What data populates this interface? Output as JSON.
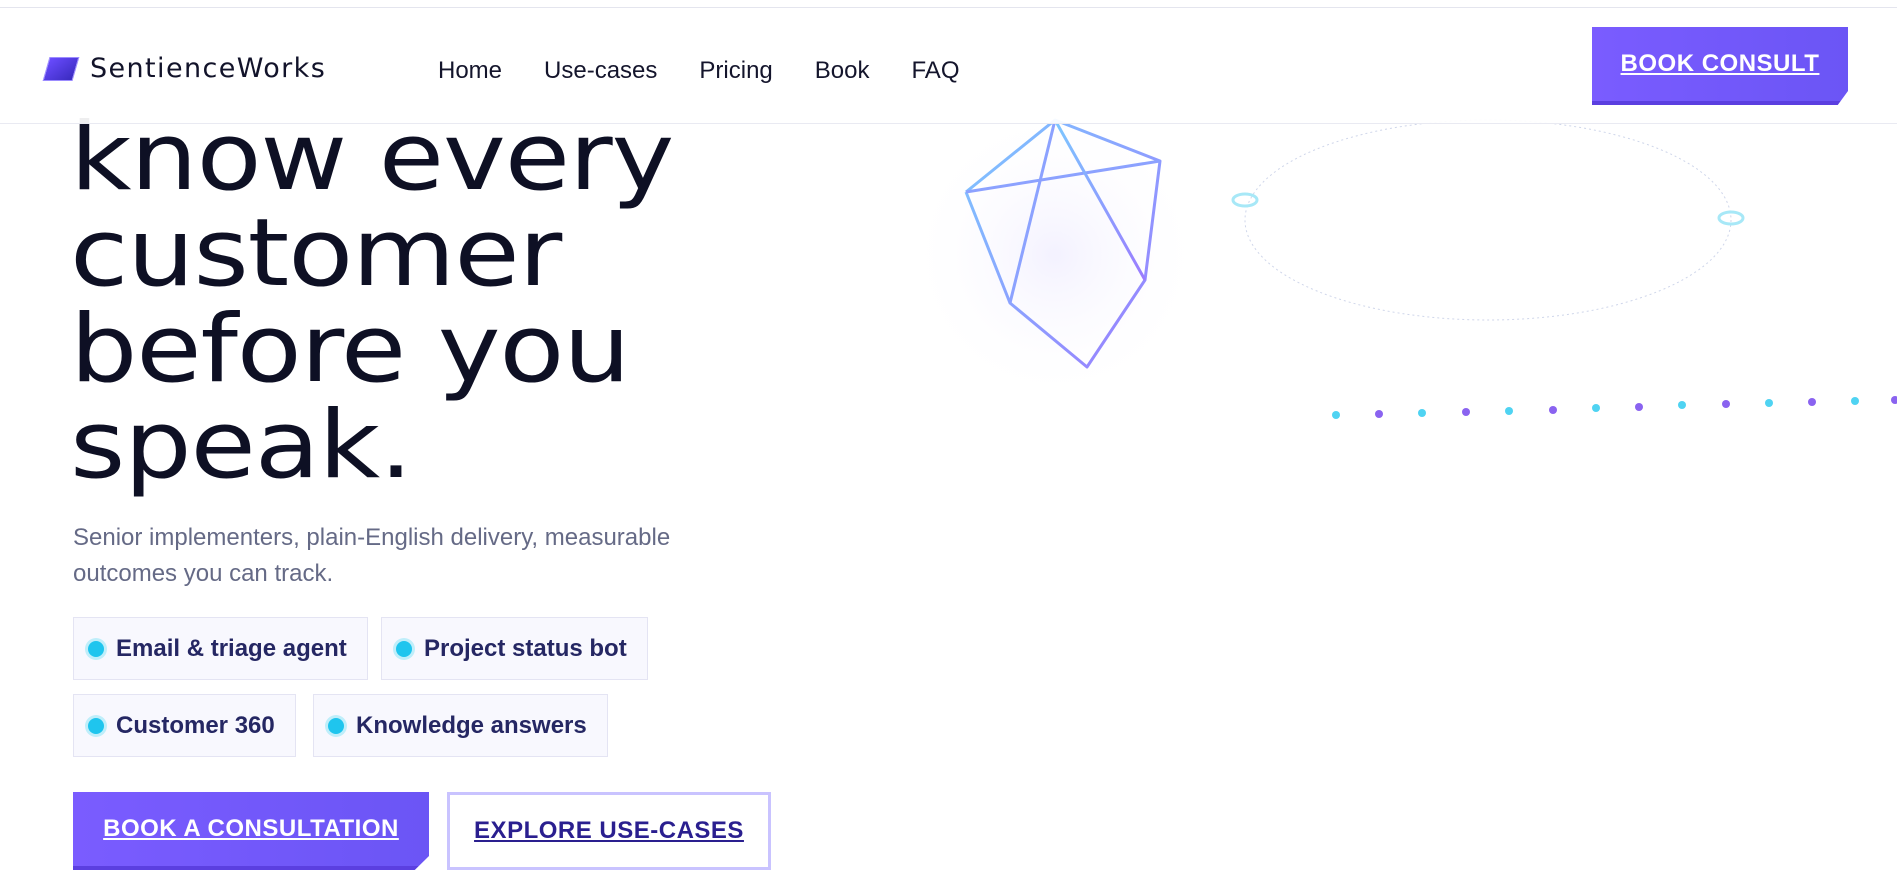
{
  "header": {
    "brand": "SentienceWorks",
    "nav": [
      {
        "label": "Home"
      },
      {
        "label": "Use-cases"
      },
      {
        "label": "Pricing"
      },
      {
        "label": "Book"
      },
      {
        "label": "FAQ"
      }
    ],
    "cta_label": "BOOK CONSULT"
  },
  "hero": {
    "headline_lines": [
      "know every",
      "customer",
      "before you",
      "speak."
    ],
    "subtitle": "Senior implementers, plain-English delivery, measurable outcomes you can track.",
    "chips": [
      {
        "label": "Email & triage agent"
      },
      {
        "label": "Project status bot"
      },
      {
        "label": "Customer 360"
      },
      {
        "label": "Knowledge answers"
      }
    ],
    "primary_cta": "BOOK A CONSULTATION",
    "secondary_cta": "EXPLORE USE-CASES"
  },
  "colors": {
    "accent": "#7a5cff",
    "chip_dot": "#1fc5ee",
    "headline": "#0e1024"
  }
}
